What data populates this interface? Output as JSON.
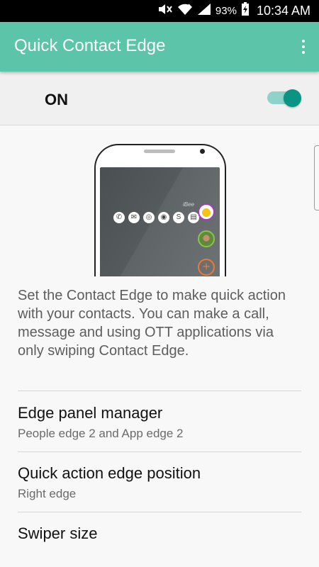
{
  "status_bar": {
    "battery_percent": "93%",
    "time": "10:34 AM"
  },
  "app_bar": {
    "title": "Quick Contact Edge",
    "overflow_icon": "more-vert-icon"
  },
  "master_switch": {
    "label": "ON",
    "checked": true,
    "accent": "#0a9484"
  },
  "preview": {
    "contact_name": "iBee",
    "action_icons": [
      "phone",
      "message",
      "whatsapp",
      "viber",
      "skype",
      "email"
    ],
    "add_symbol": "+"
  },
  "description": "Set the Contact Edge to make quick action with your contacts. You can make a call, message and using OTT applications via only swiping Contact Edge.",
  "preferences": [
    {
      "title": "Edge panel manager",
      "summary": "People edge 2 and App edge 2"
    },
    {
      "title": "Quick action edge position",
      "summary": "Right edge"
    },
    {
      "title": "Swiper size",
      "summary": ""
    }
  ],
  "colors": {
    "app_bar": "#5cc4a8",
    "status_bar": "#000000",
    "background": "#f8f8f8"
  }
}
